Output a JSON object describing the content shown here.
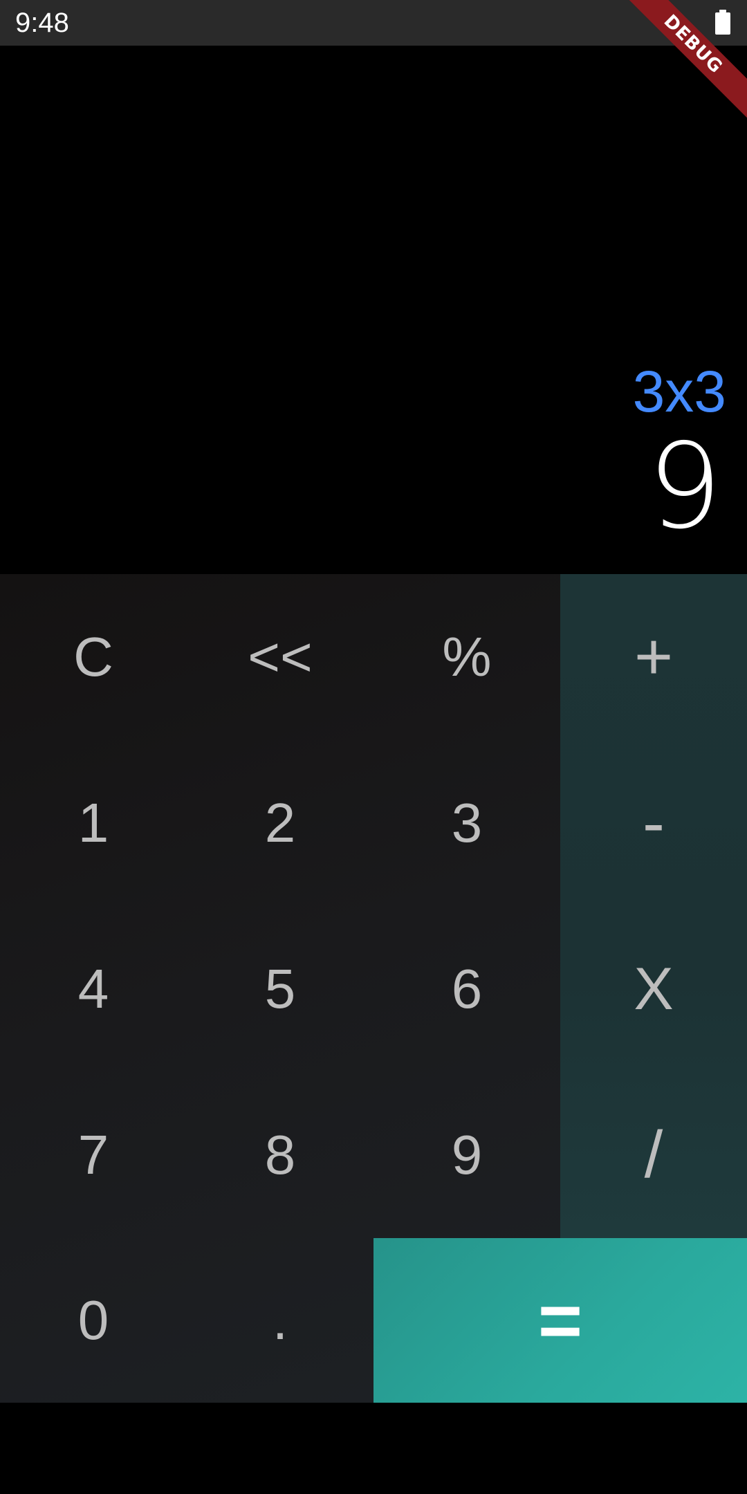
{
  "status_bar": {
    "time": "9:48",
    "battery_icon": "battery-full-icon"
  },
  "debug_banner": "DEBUG",
  "display": {
    "expression": "3x3",
    "result": "9",
    "expression_color": "#448aff"
  },
  "keys": {
    "clear": "C",
    "backspace": "<<",
    "percent": "%",
    "plus": "+",
    "one": "1",
    "two": "2",
    "three": "3",
    "minus": "-",
    "four": "4",
    "five": "5",
    "six": "6",
    "multiply": "X",
    "seven": "7",
    "eight": "8",
    "nine": "9",
    "divide": "/",
    "zero": "0",
    "dot": ".",
    "equals": "="
  },
  "colors": {
    "operator_column": "#1d3436",
    "equals_button": "#2aa99d",
    "key_text": "#bdbdbd"
  }
}
